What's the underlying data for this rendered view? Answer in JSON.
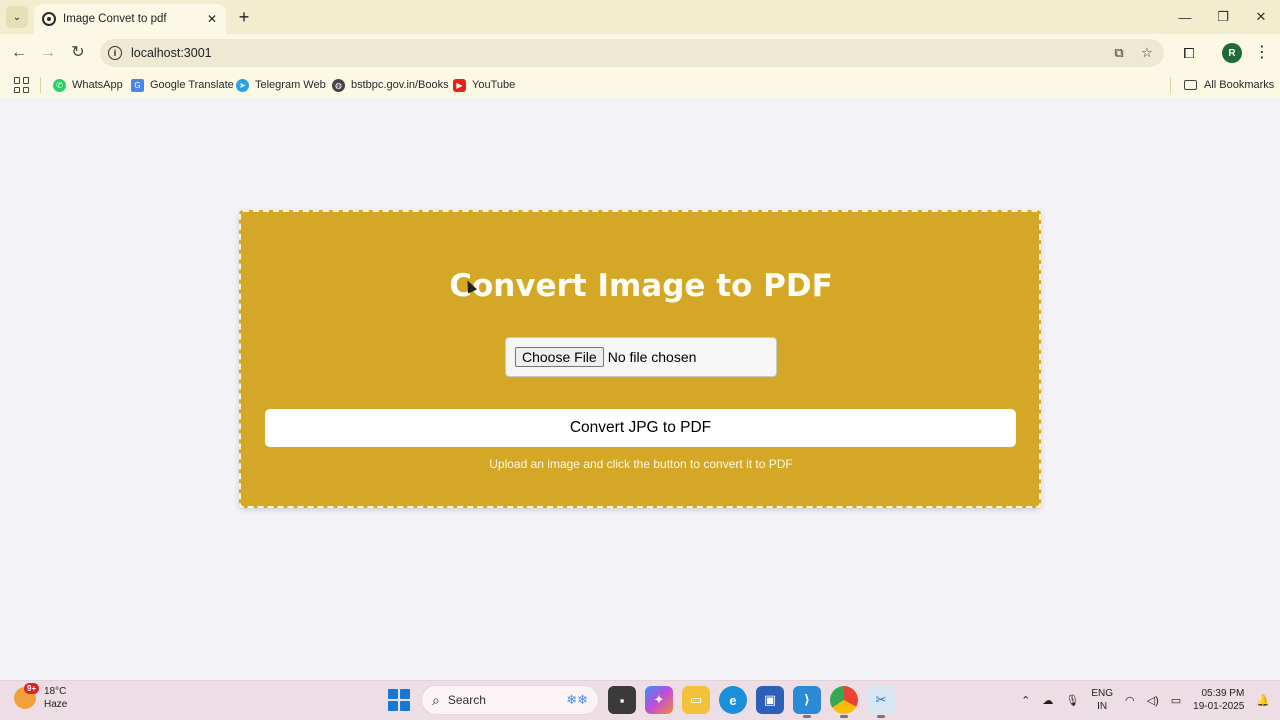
{
  "browser": {
    "tab_title": "Image Convet to pdf",
    "new_tab_symbol": "+",
    "url": "localhost:3001",
    "profile_initial": "R",
    "bookmarks": [
      {
        "label": "WhatsApp",
        "icon": "whatsapp-icon",
        "color": "#25d366"
      },
      {
        "label": "Google Translate",
        "icon": "google-translate-icon",
        "color": "#4a86e8"
      },
      {
        "label": "Telegram Web",
        "icon": "telegram-icon",
        "color": "#2aa3df"
      },
      {
        "label": "bstbpc.gov.in/Books",
        "icon": "globe-icon",
        "color": "#444444"
      },
      {
        "label": "YouTube",
        "icon": "youtube-icon",
        "color": "#e62117"
      }
    ],
    "all_bookmarks": "All Bookmarks"
  },
  "page": {
    "title": "Convert Image to PDF",
    "file_button": "Choose File",
    "file_status": "No file chosen",
    "convert_button": "Convert JPG to PDF",
    "hint": "Upload an image and click the button to convert it to PDF",
    "card_color": "#d4a826",
    "background": "#f3f2f7"
  },
  "taskbar": {
    "weather_temp": "18°C",
    "weather_desc": "Haze",
    "weather_badge": "9+",
    "search_placeholder": "Search",
    "lang_top": "ENG",
    "lang_bottom": "IN",
    "time": "05:39 PM",
    "date": "19-01-2025"
  }
}
